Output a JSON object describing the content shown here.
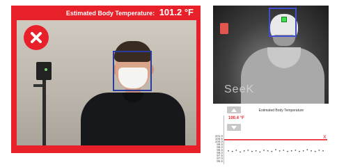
{
  "camera": {
    "banner_label": "Estimated Body Temperature:",
    "banner_value": "101.2 °F",
    "status": "fever-alert",
    "status_color": "#e8202a"
  },
  "thermal": {
    "brand": "SeeK",
    "box_color": "#3f4ecb"
  },
  "graph": {
    "title": "Estimated Body Temperature",
    "threshold_label": "100.4 °F",
    "threshold_marker": "X",
    "threshold_color": "#e8202a",
    "y_ticks": [
      "101.0",
      "100.5",
      "100.0",
      "99.5",
      "99.0",
      "98.5",
      "98.0",
      "97.5",
      "97.0",
      "96.5"
    ],
    "ylim": [
      96.5,
      101.0
    ],
    "threshold": 100.4,
    "readings": [
      98.4,
      98.3,
      98.5,
      98.2,
      98.4,
      98.5,
      98.3,
      98.4,
      98.2,
      98.5,
      98.4,
      98.3,
      98.6,
      98.4,
      98.5,
      98.3,
      98.4,
      98.5,
      98.3,
      98.4,
      98.6,
      98.4,
      98.3,
      98.5,
      98.4
    ]
  }
}
